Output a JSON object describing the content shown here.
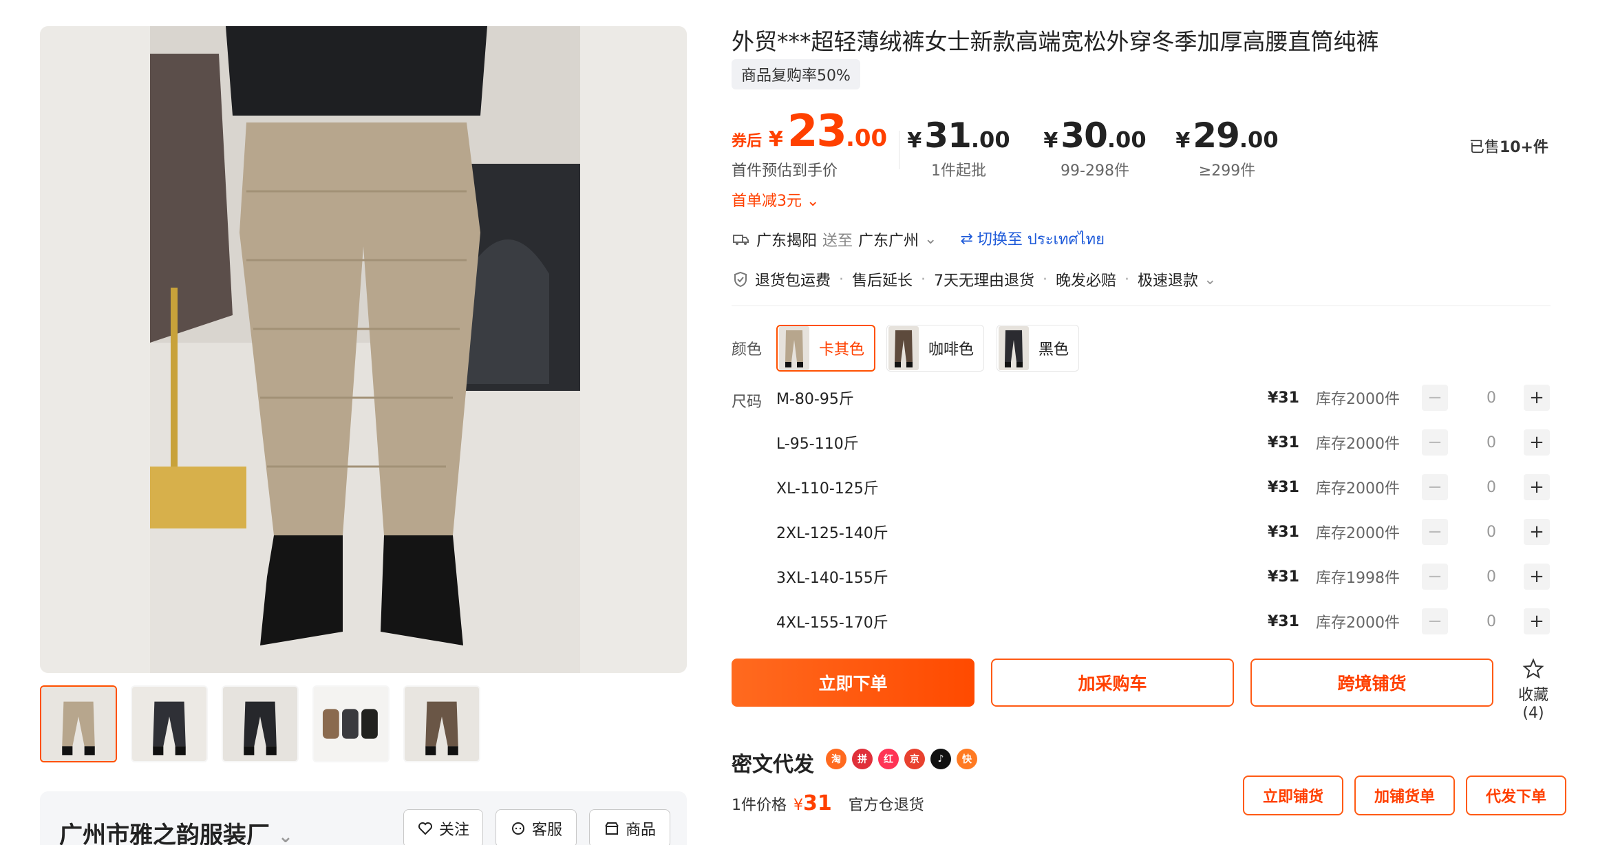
{
  "product": {
    "title": "外贸***超轻薄绒裤女士新款高端宽松外穿冬季加厚高腰直筒纯裤",
    "badge": "商品复购率50%"
  },
  "price": {
    "coupon_label": "券后",
    "yen": "¥",
    "int": "23",
    "dec": ".00",
    "hint": "首件预估到手价",
    "first_discount": "首单减3元"
  },
  "tiers": [
    {
      "yen": "¥",
      "int": "31",
      "dec": ".00",
      "qty": "1件起批"
    },
    {
      "yen": "¥",
      "int": "30",
      "dec": ".00",
      "qty": "99-298件"
    },
    {
      "yen": "¥",
      "int": "29",
      "dec": ".00",
      "qty": "≥299件"
    }
  ],
  "sold": {
    "prefix": "已售",
    "count": "10+件"
  },
  "shipping": {
    "from": "广东揭阳",
    "to_label": "送至",
    "to": "广东广州",
    "switch": "切换至 ประเทศไทย"
  },
  "guarantees": [
    "退货包运费",
    "售后延长",
    "7天无理由退货",
    "晚发必赔",
    "极速退款"
  ],
  "colors": {
    "label": "颜色",
    "items": [
      {
        "name": "卡其色",
        "color": "#b7a68d"
      },
      {
        "name": "咖啡色",
        "color": "#5d4a3c"
      },
      {
        "name": "黑色",
        "color": "#2b2b30"
      }
    ]
  },
  "sizes": {
    "label": "尺码",
    "rows": [
      {
        "name": "M-80-95斤",
        "price": "¥31",
        "stock": "库存2000件",
        "qty": "0"
      },
      {
        "name": "L-95-110斤",
        "price": "¥31",
        "stock": "库存2000件",
        "qty": "0"
      },
      {
        "name": "XL-110-125斤",
        "price": "¥31",
        "stock": "库存2000件",
        "qty": "0"
      },
      {
        "name": "2XL-125-140斤",
        "price": "¥31",
        "stock": "库存2000件",
        "qty": "0"
      },
      {
        "name": "3XL-140-155斤",
        "price": "¥31",
        "stock": "库存1998件",
        "qty": "0"
      },
      {
        "name": "4XL-155-170斤",
        "price": "¥31",
        "stock": "库存2000件",
        "qty": "0"
      }
    ]
  },
  "actions": {
    "buy_now": "立即下单",
    "add_cart": "加采购车",
    "cross_border": "跨境铺货",
    "favorite": "收藏 (4)"
  },
  "dropship": {
    "title": "密文代发",
    "unit_label": "1件价格",
    "yen": "¥",
    "unit_price": "31",
    "note": "官方仓退货",
    "btn_distribute": "立即铺货",
    "btn_add_list": "加铺货单",
    "btn_order": "代发下单"
  },
  "shop": {
    "name": "广州市雅之韵服装厂",
    "follow": "关注",
    "service": "客服",
    "products": "商品"
  },
  "colors_theme": {
    "accent": "#ff5000",
    "link": "#1f5bd9"
  }
}
